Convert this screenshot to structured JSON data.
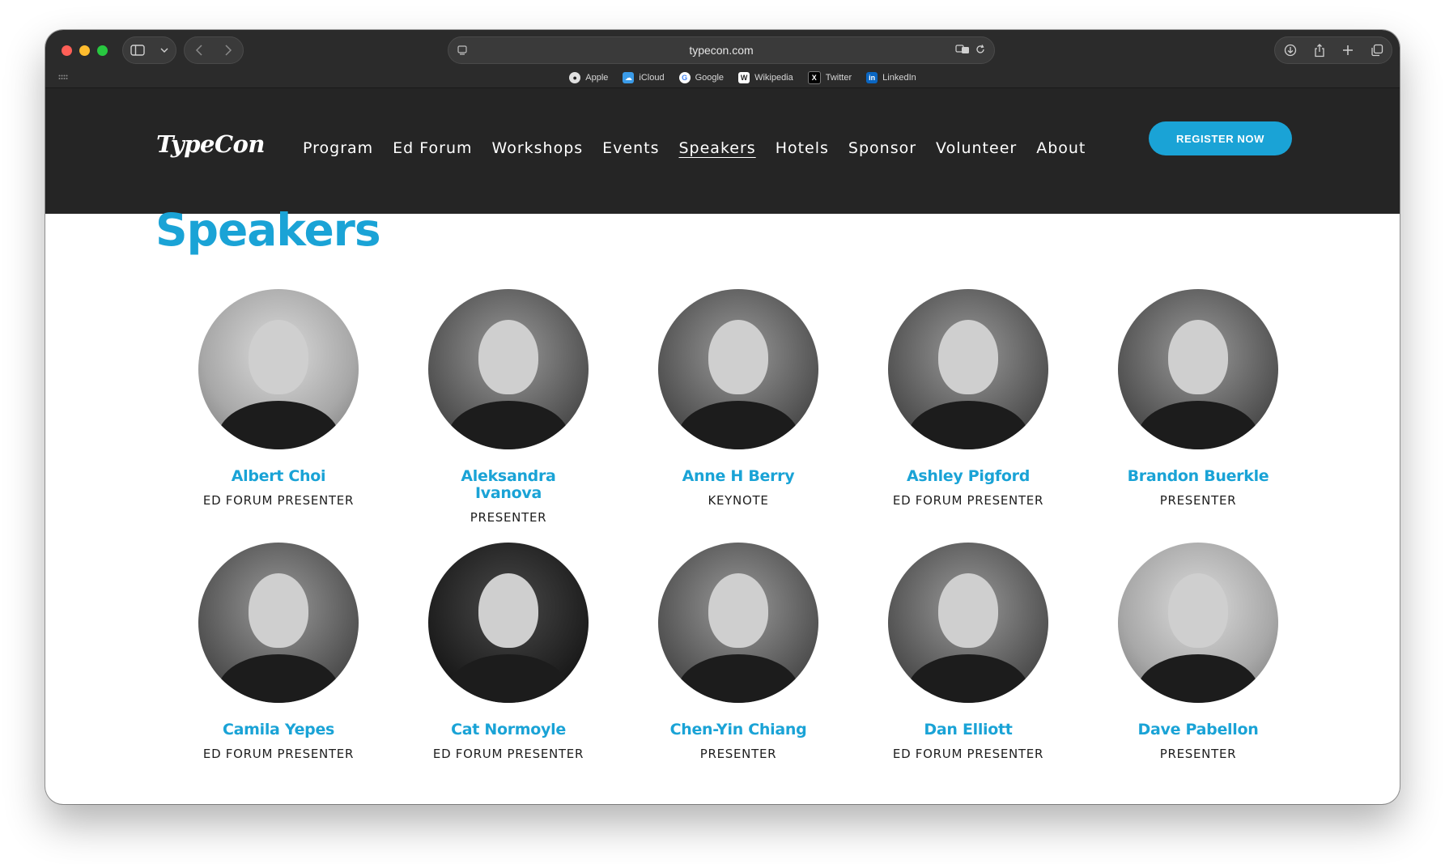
{
  "browser": {
    "url": "typecon.com",
    "favorites": [
      {
        "label": "Apple",
        "icon": "apple-icon",
        "color": "#ffffff"
      },
      {
        "label": "iCloud",
        "icon": "icloud-icon",
        "color": "#3a9be8"
      },
      {
        "label": "Google",
        "icon": "google-icon",
        "color": "#ffffff"
      },
      {
        "label": "Wikipedia",
        "icon": "wikipedia-icon",
        "color": "#ffffff"
      },
      {
        "label": "Twitter",
        "icon": "x-icon",
        "color": "#000000"
      },
      {
        "label": "LinkedIn",
        "icon": "linkedin-icon",
        "color": "#0a66c2"
      }
    ]
  },
  "header": {
    "logo": "TypeCon",
    "nav": [
      "Program",
      "Ed Forum",
      "Workshops",
      "Events",
      "Speakers",
      "Hotels",
      "Sponsor",
      "Volunteer",
      "About"
    ],
    "active_nav": "Speakers",
    "cta": "REGISTER NOW"
  },
  "main": {
    "title": "Speakers",
    "speakers": [
      {
        "name": "Albert Choi",
        "role": "ED FORUM PRESENTER"
      },
      {
        "name": "Aleksandra Ivanova",
        "role": "PRESENTER"
      },
      {
        "name": "Anne H Berry",
        "role": "KEYNOTE"
      },
      {
        "name": "Ashley Pigford",
        "role": "ED FORUM PRESENTER"
      },
      {
        "name": "Brandon Buerkle",
        "role": "PRESENTER"
      },
      {
        "name": "Camila Yepes",
        "role": "ED FORUM PRESENTER"
      },
      {
        "name": "Cat Normoyle",
        "role": "ED FORUM PRESENTER"
      },
      {
        "name": "Chen-Yin Chiang",
        "role": "PRESENTER"
      },
      {
        "name": "Dan Elliott",
        "role": "ED FORUM PRESENTER"
      },
      {
        "name": "Dave Pabellon",
        "role": "PRESENTER"
      }
    ]
  },
  "colors": {
    "accent": "#1aa3d6",
    "header_bg": "#252525"
  }
}
